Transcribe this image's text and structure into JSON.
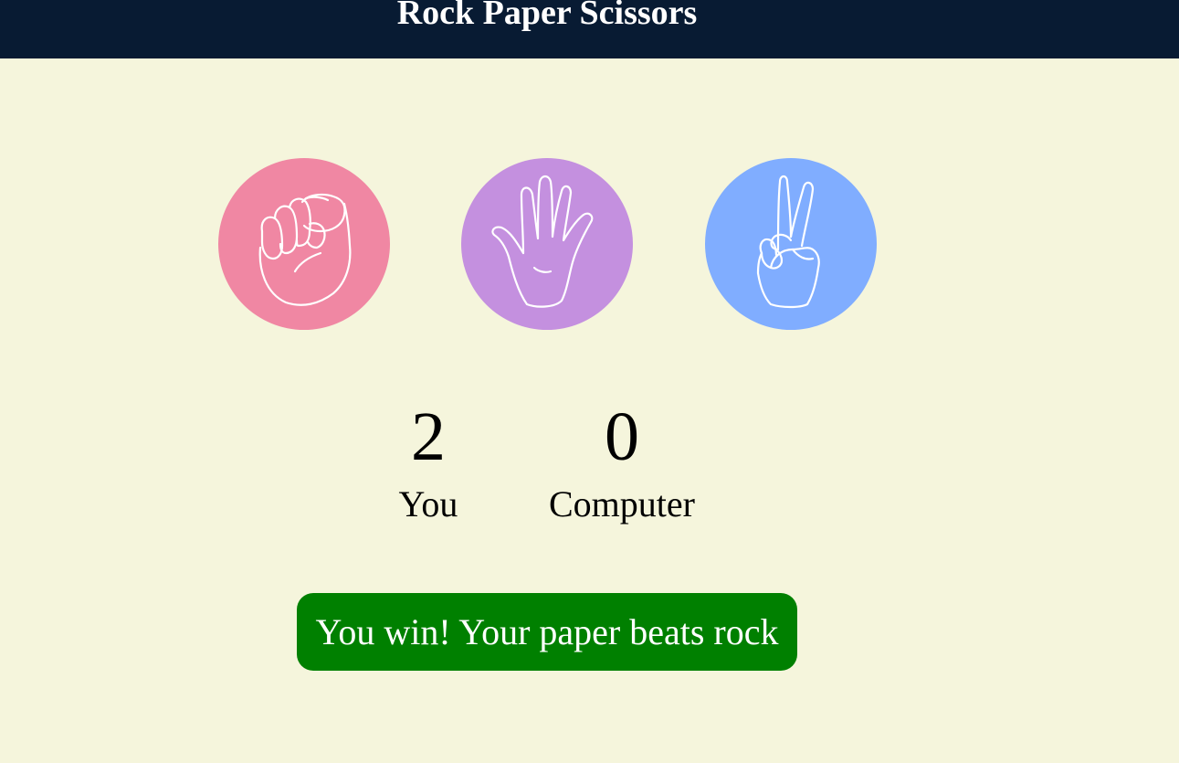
{
  "header": {
    "title": "Rock Paper Scissors",
    "background": "#081b33"
  },
  "choices": [
    {
      "name": "rock",
      "icon": "fist-icon",
      "color": "#f087a3"
    },
    {
      "name": "paper",
      "icon": "open-hand-icon",
      "color": "#c490df"
    },
    {
      "name": "scissors",
      "icon": "peace-hand-icon",
      "color": "#80adff"
    }
  ],
  "score": {
    "you": {
      "value": "2",
      "label": "You"
    },
    "computer": {
      "value": "0",
      "label": "Computer"
    }
  },
  "result": {
    "message": "You win! Your paper beats rock",
    "color": "#008000"
  },
  "page_background": "#f5f5dc"
}
